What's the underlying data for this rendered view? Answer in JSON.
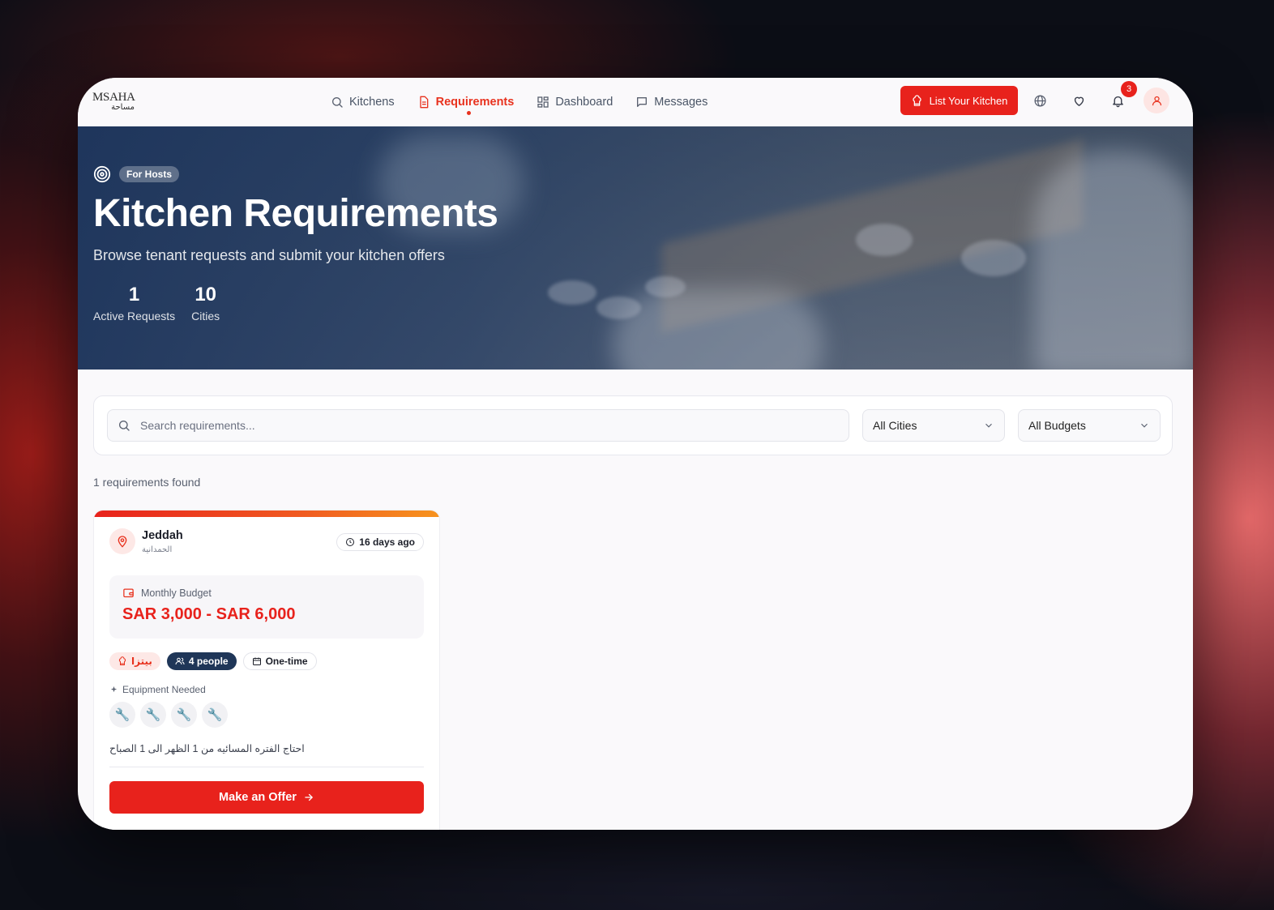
{
  "brand": {
    "logo_en": "MSAHA",
    "logo_ar": "مساحة"
  },
  "nav": {
    "links": [
      {
        "label": "Kitchens",
        "icon": "search-icon"
      },
      {
        "label": "Requirements",
        "icon": "document-icon",
        "active": true
      },
      {
        "label": "Dashboard",
        "icon": "grid-icon"
      },
      {
        "label": "Messages",
        "icon": "chat-icon"
      }
    ],
    "list_kitchen_label": "List Your Kitchen",
    "notification_count": "3"
  },
  "hero": {
    "tag": "For Hosts",
    "title": "Kitchen Requirements",
    "subtitle": "Browse tenant requests and submit your kitchen offers",
    "stats": [
      {
        "value": "1",
        "label": "Active Requests"
      },
      {
        "value": "10",
        "label": "Cities"
      }
    ]
  },
  "filters": {
    "search_placeholder": "Search requirements...",
    "city_selected": "All Cities",
    "budget_selected": "All Budgets"
  },
  "results_text": "1 requirements found",
  "card": {
    "city": "Jeddah",
    "district": "الحمدانية",
    "posted": "16 days ago",
    "budget_label": "Monthly Budget",
    "budget_value": "SAR 3,000 - SAR 6,000",
    "cuisine": "بيتزا",
    "people": "4 people",
    "frequency": "One-time",
    "equipment_label": "Equipment Needed",
    "equipment_icons": [
      "🔧",
      "🔧",
      "🔧",
      "🔧"
    ],
    "note": "احتاج الفتره المسائيه من 1 الظهر الى 1 الصباح",
    "offer_label": "Make an Offer"
  },
  "colors": {
    "accent": "#e8221c",
    "navy": "#1f3658"
  }
}
